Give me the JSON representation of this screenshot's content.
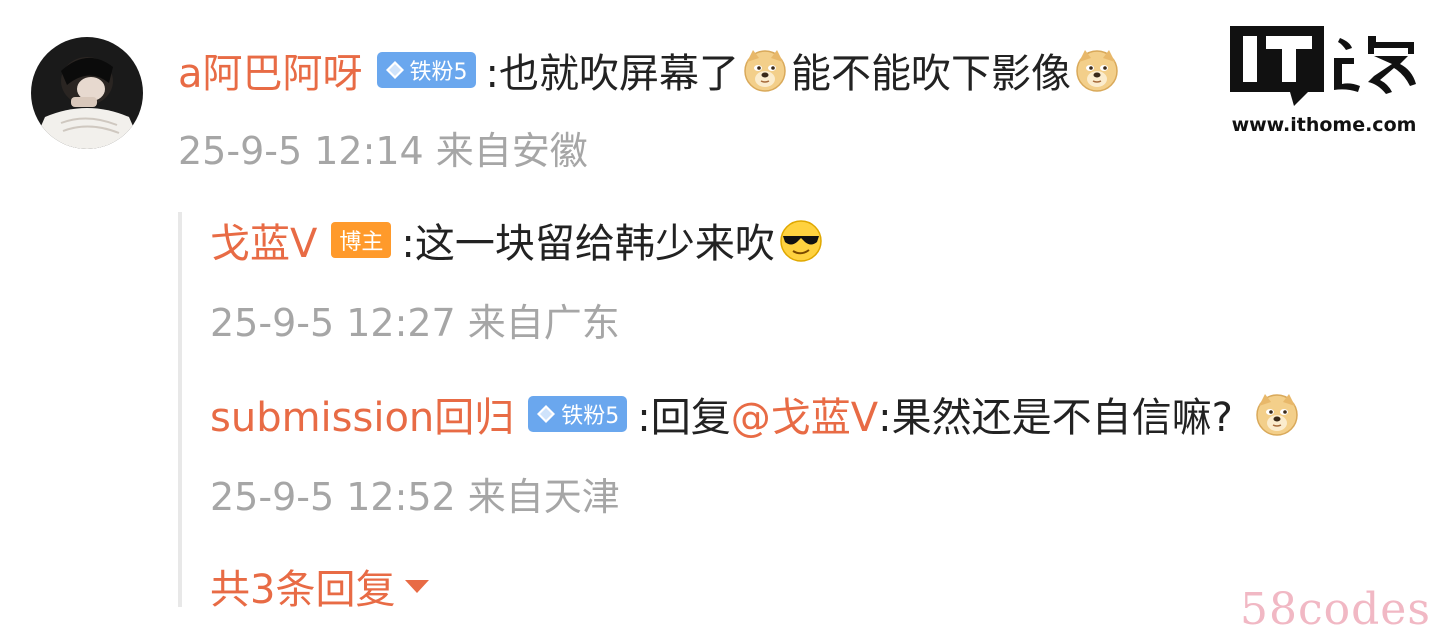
{
  "main_comment": {
    "username": "a阿巴阿呀",
    "badge": "铁粉5",
    "text_part1": ":也就吹屏幕了",
    "text_part2": "能不能吹下影像",
    "emoji": "doge-emoji",
    "meta": "25-9-5 12:14 来自安徽"
  },
  "replies": [
    {
      "username": "戈蓝V",
      "badge": "博主",
      "text": ":这一块留给韩少来吹",
      "emoji": "sunglasses-emoji",
      "meta": "25-9-5 12:27 来自广东"
    },
    {
      "username": "submission回归",
      "badge": "铁粉5",
      "text_prefix": ":回复",
      "mention": "@戈蓝V",
      "text_suffix": ":果然还是不自信嘛?",
      "emoji": "doge-emoji",
      "meta": "25-9-5 12:52 来自天津"
    }
  ],
  "more_replies_label": "共3条回复",
  "logo": {
    "brand_text": "IT之家",
    "url": "www.ithome.com"
  },
  "watermark": "58codes",
  "colors": {
    "username": "#e86b45",
    "meta": "#a6a6a6",
    "fan_badge": "#6aa7ee",
    "blogger_badge": "#ff9a2b",
    "watermark": "#f1b8c4"
  }
}
